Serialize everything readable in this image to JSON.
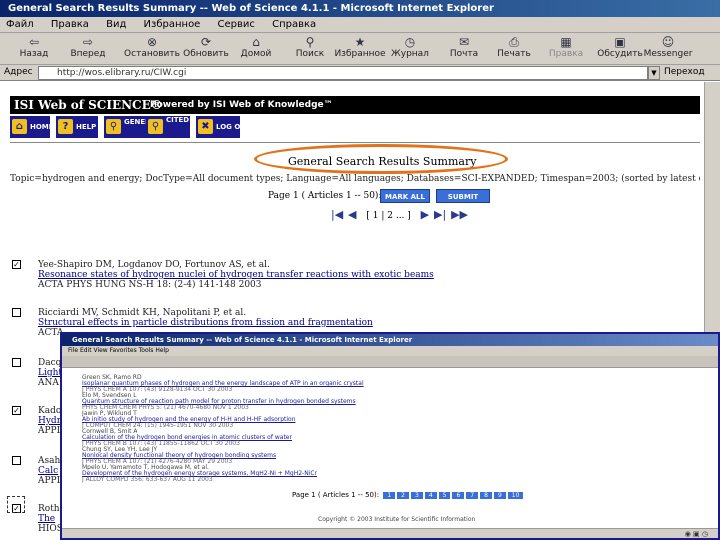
{
  "window": {
    "title": "General Search Results Summary -- Web of Science 4.1.1 - Microsoft Internet Explorer"
  },
  "menu": [
    "Файл",
    "Правка",
    "Вид",
    "Избранное",
    "Сервис",
    "Справка"
  ],
  "toolbar": [
    {
      "label": "Назад",
      "icon": "back-arrow-icon"
    },
    {
      "label": "Вперед",
      "icon": "forward-arrow-icon"
    },
    {
      "label": "Остановить",
      "icon": "stop-icon"
    },
    {
      "label": "Обновить",
      "icon": "refresh-icon"
    },
    {
      "label": "Домой",
      "icon": "home-icon"
    },
    {
      "label": "Поиск",
      "icon": "search-icon"
    },
    {
      "label": "Избранное",
      "icon": "favorites-icon"
    },
    {
      "label": "Журнал",
      "icon": "history-icon"
    },
    {
      "label": "Почта",
      "icon": "mail-icon"
    },
    {
      "label": "Печать",
      "icon": "print-icon"
    },
    {
      "label": "Правка",
      "icon": "edit-icon"
    },
    {
      "label": "Обсудить",
      "icon": "discuss-icon"
    },
    {
      "label": "Messenger",
      "icon": "messenger-icon"
    }
  ],
  "address": {
    "label": "Адрес",
    "value": "http://wos.elibrary.ru/CIW.cgi",
    "go": "Переход"
  },
  "isi": {
    "logo": "ISI Web of SCIENCE®",
    "powered": "Powered by ISI Web of Knowledge™"
  },
  "nav": [
    "HOME",
    "HELP",
    "GENERAL SEARCH",
    "CITED REF SEARCH",
    "LOG OFF"
  ],
  "results": {
    "title": "General Search Results  Summary",
    "query": "Topic=hydrogen and energy; DocType=All document types; Language=All languages; Databases=SCI-EXPANDED; Timespan=2003; (sorted by latest date)",
    "page_info": "Page 1 ( Articles 1 -- 50):",
    "mark_all": "MARK ALL",
    "submit_marks": "SUBMIT MARKS",
    "pages": "[ 1 | 2 ... ]"
  },
  "records": [
    {
      "checked": true,
      "authors": "Yee-Shapiro DM, Logdanov DO, Fortunov AS, et al.",
      "title": "Resonance states of hydrogen nuclei of hydrogen transfer reactions with exotic beams",
      "source": "ACTA PHYS HUNG NS-H 18: (2-4) 141-148 2003"
    },
    {
      "checked": false,
      "authors": "Ricciardi MV, Schmidt KH, Napolitani P, et al.",
      "title": "Structural effects in particle distributions from fission and fragmentation",
      "source": "ACTA"
    },
    {
      "checked": false,
      "authors": "Dacquay",
      "title": "Light",
      "source": "ANA"
    },
    {
      "checked": true,
      "authors": "Kadouri",
      "title": "Hydro",
      "source": "APPL"
    },
    {
      "checked": false,
      "authors": "Asahi",
      "title": "Calc",
      "source": "APPL"
    },
    {
      "checked": true,
      "authors": "Roth TA",
      "title": "The",
      "source": "HIOS"
    }
  ],
  "overlay": {
    "title": "General Search Results Summary -- Web of Science 4.1.1 - Microsoft Internet Explorer",
    "menu": "File   Edit   View   Favorites   Tools   Help",
    "lines": [
      {
        "k": "a",
        "text": "Green SK, Ramo RD"
      },
      {
        "k": "t",
        "text": "Isoplanar quantum phases of hydrogen and the energy landscape of ATP in an organic crystal"
      },
      {
        "k": "s",
        "text": "J PHYS CHEM A 107: (43) 9128-9134 OCT 30 2003"
      },
      {
        "k": "a",
        "text": "Elo M, Svendsen L"
      },
      {
        "k": "t",
        "text": "Quantum structure of reaction path model for proton transfer in hydrogen bonded systems"
      },
      {
        "k": "s",
        "text": "PHYS CHEM CHEM PHYS 5: (21) 4670-4680 NOV 1 2003"
      },
      {
        "k": "a",
        "text": "Jawin P, Wiklund T"
      },
      {
        "k": "t",
        "text": "Ab initio study of hydrogen and the energy of H-H and H-HF adsorption"
      },
      {
        "k": "s",
        "text": "J COMPUT CHEM 24: (15) 1945-1951 NOV 30 2003"
      },
      {
        "k": "a",
        "text": "Cornwell B, Smit A"
      },
      {
        "k": "t",
        "text": "Calculation of the hydrogen bond energies in atomic clusters of water"
      },
      {
        "k": "s",
        "text": "J PHYS CHEM B 107: (43) 11855-11862 OCT 30 2003"
      },
      {
        "k": "a",
        "text": "Chung SY, Lee YH, Lee JY"
      },
      {
        "k": "t",
        "text": "Nonlocal density functional theory of hydrogen bonding systems"
      },
      {
        "k": "s",
        "text": "J PHYS CHEM A 107: (21) 4276-4280 MAY 29 2003"
      },
      {
        "k": "a",
        "text": "Mpelo U, Yamamoto T, Hodogawa M, et al."
      },
      {
        "k": "t",
        "text": "Development of the hydrogen energy storage systems, MgH2-Ni + MgH2-NiCr"
      },
      {
        "k": "s",
        "text": "J ALLOY COMPD 356: 633-637 AUG 11 2003"
      }
    ],
    "pager": "Page 1 ( Articles 1 -- 50):",
    "pills": [
      "1",
      "2",
      "3",
      "4",
      "5",
      "6",
      "7",
      "8",
      "9",
      "10"
    ],
    "footer": "Copyright © 2003 Institute for Scientific Information"
  },
  "colors": {
    "accent": "#e2731a",
    "titlebar": "#0a246a",
    "link": "#00008b",
    "isi_blue": "#1a1a8c",
    "button_blue": "#3b6fd8"
  }
}
